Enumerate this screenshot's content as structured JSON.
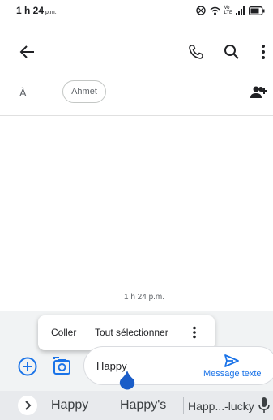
{
  "status_bar": {
    "time": "1 h 24",
    "ampm": "p.m.",
    "icons": [
      "nfc-icon",
      "wifi-icon",
      "volte-icon",
      "signal-icon",
      "battery-icon"
    ],
    "volte_text": "Vo",
    "lte_text": "LTE"
  },
  "app_bar": {
    "icons": [
      "back-arrow-icon",
      "phone-icon",
      "search-icon",
      "more-vert-icon"
    ]
  },
  "recipient": {
    "to_label": "À",
    "chip_name": "Ahmet",
    "add_icon": "add-people-icon"
  },
  "conversation": {
    "timestamp": "1 h 24 p.m."
  },
  "context_menu": {
    "paste_label": "Coller",
    "select_all_label": "Tout sélectionner",
    "more_icon": "more-vert-icon"
  },
  "compose": {
    "input_value": "Happy",
    "send_label": "Message texte",
    "accent_color": "#1a73e8"
  },
  "suggestions": {
    "items": [
      "Happy",
      "Happy's",
      "Happ...-lucky"
    ],
    "expand_icon": "chevron-right-icon",
    "mic_icon": "mic-icon"
  }
}
